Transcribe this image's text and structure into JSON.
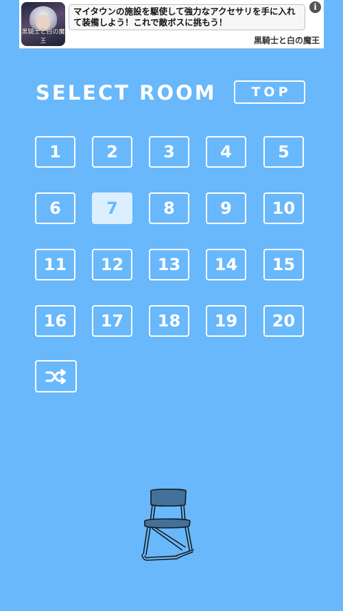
{
  "ad": {
    "thumb_caption": "黒騎士と白の魔王",
    "text": "マイタウンの施設を駆使して強力なアクセサリを手に入れて装備しよう！これで敵ボスに挑もう！",
    "source": "黒騎士と白の魔王",
    "info_glyph": "i"
  },
  "header": {
    "title": "SELECT ROOM",
    "top_button": "TOP"
  },
  "rooms": [
    "1",
    "2",
    "3",
    "4",
    "5",
    "6",
    "7",
    "8",
    "9",
    "10",
    "11",
    "12",
    "13",
    "14",
    "15",
    "16",
    "17",
    "18",
    "19",
    "20"
  ],
  "selected_room": "7",
  "shuffle": {
    "icon": "shuffle-icon"
  },
  "chair": {
    "icon": "folding-chair-icon"
  },
  "colors": {
    "background": "#68b8fb",
    "selected_fill": "#dcefff",
    "text": "#ffffff"
  }
}
